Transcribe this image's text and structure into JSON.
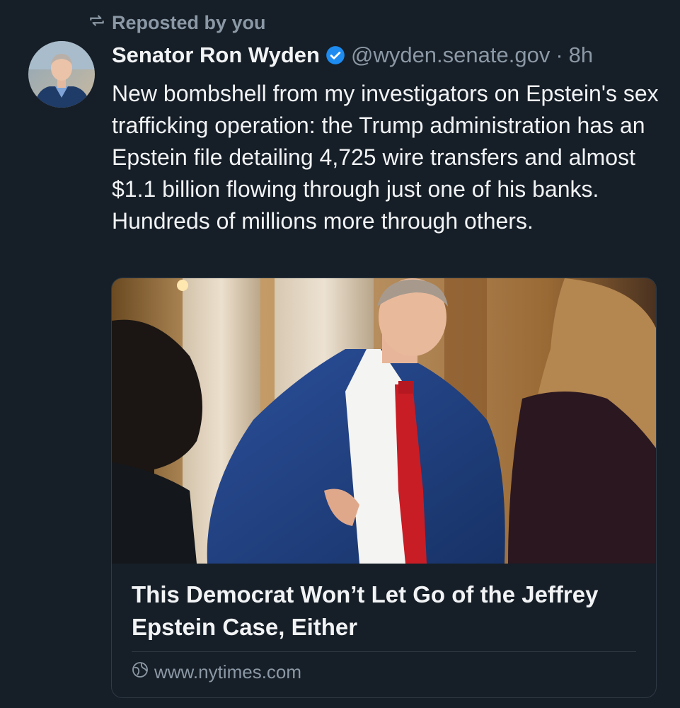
{
  "repost": {
    "icon": "repost-icon",
    "label": "Reposted by you"
  },
  "post": {
    "author_name": "Senator Ron Wyden",
    "verified_icon": "verified-badge-icon",
    "handle": "@wyden.senate.gov",
    "separator": "·",
    "time": "8h",
    "text": "New bombshell from my investigators on Epstein's sex trafficking operation: the Trump administration has an Epstein file detailing 4,725 wire transfers and almost $1.1 billion flowing through just one of his banks. Hundreds of millions more through others."
  },
  "link_card": {
    "title": "This Democrat Won’t Let Go of the Jeffrey Epstein Case, Either",
    "domain_icon": "globe-icon",
    "domain": "www.nytimes.com"
  },
  "colors": {
    "background": "#161e27",
    "muted_text": "#8b98a5",
    "primary_text": "#f1f3f5",
    "verified_blue": "#1d8bf0",
    "border": "#2e3a46"
  }
}
